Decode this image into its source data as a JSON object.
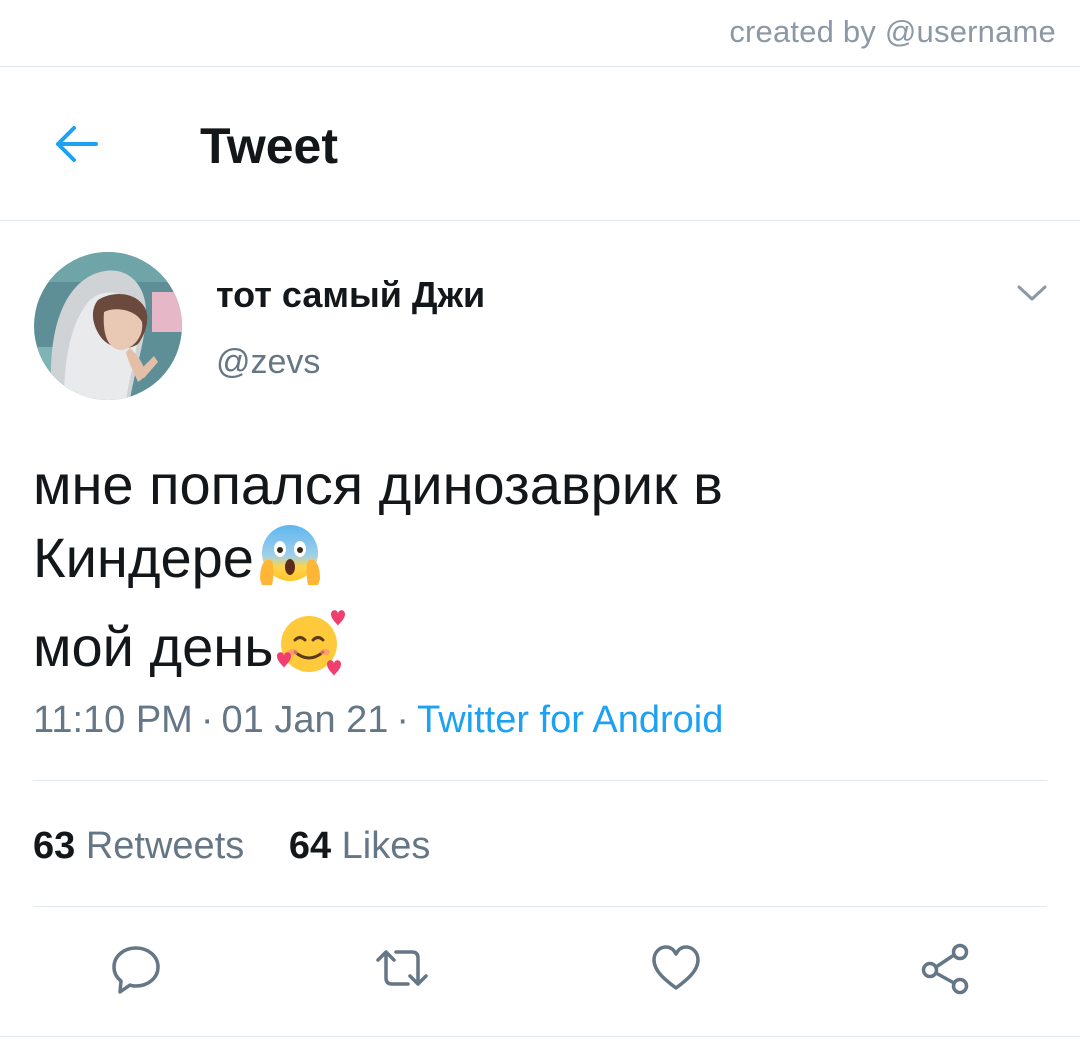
{
  "watermark": "created by @username",
  "header": {
    "title": "Tweet",
    "back_icon": "arrow-left-icon"
  },
  "tweet": {
    "author": {
      "display_name": "тот самый Джи",
      "handle": "@zevs"
    },
    "text_lines": [
      "мне попался динозаврик в",
      "Киндере",
      "мой день"
    ],
    "emojis": [
      "face-screaming-in-fear",
      "smiling-face-with-hearts"
    ],
    "time": "11:10 PM",
    "date": "01 Jan 21",
    "separator": "·",
    "source": "Twitter for Android",
    "stats": {
      "retweets_count": "63",
      "retweets_label": "Retweets",
      "likes_count": "64",
      "likes_label": "Likes"
    }
  },
  "actions": [
    "reply-icon",
    "retweet-icon",
    "like-icon",
    "share-icon"
  ],
  "colors": {
    "accent": "#1da1f2",
    "text_primary": "#14171a",
    "text_secondary": "#657786",
    "divider": "#e1e8ed"
  }
}
